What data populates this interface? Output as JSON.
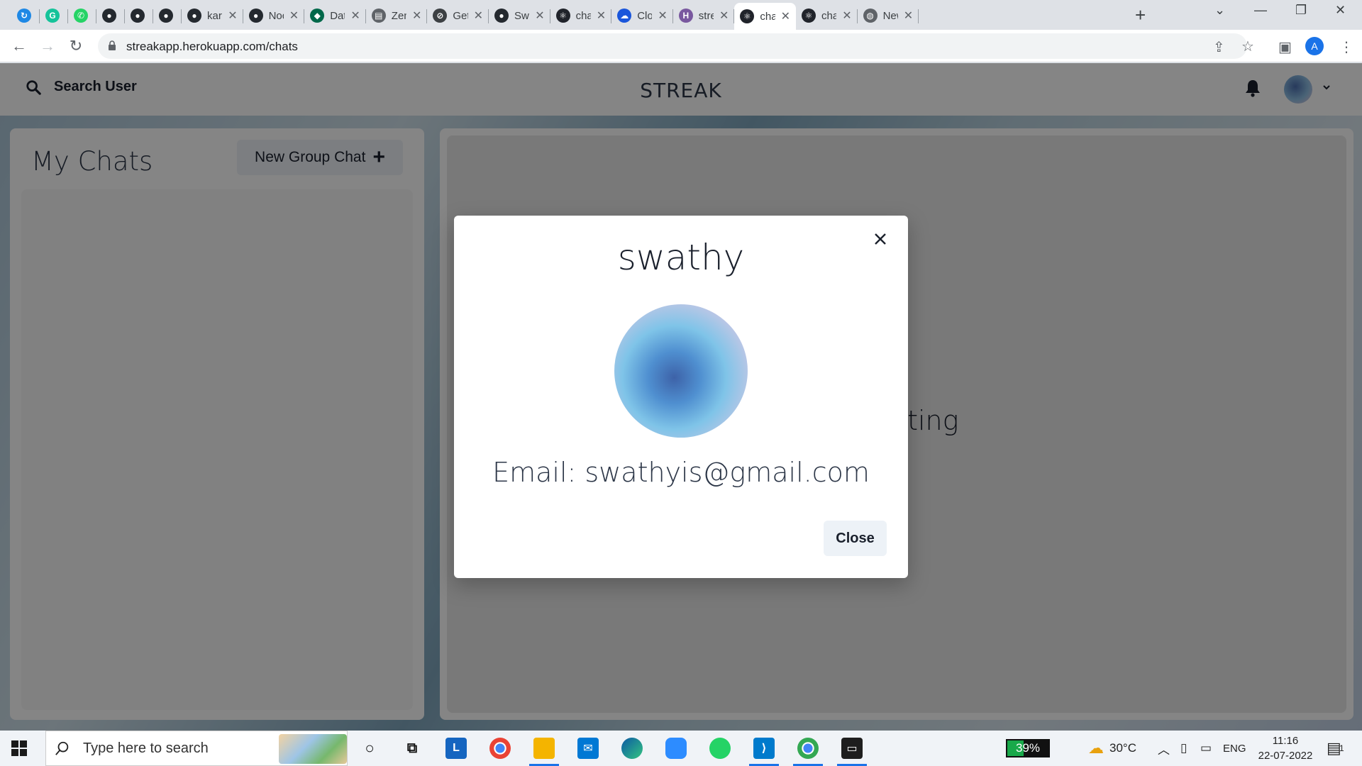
{
  "browser": {
    "tabs": [
      {
        "title": "",
        "icon": "app-icon",
        "color": "#1e88e5"
      },
      {
        "title": "",
        "icon": "grammarly-icon",
        "color": "#15c39a"
      },
      {
        "title": "",
        "icon": "whatsapp-icon",
        "color": "#25d366"
      },
      {
        "title": "",
        "icon": "github-icon",
        "color": "#24292f"
      },
      {
        "title": "",
        "icon": "github-icon",
        "color": "#24292f"
      },
      {
        "title": "",
        "icon": "github-icon",
        "color": "#24292f"
      },
      {
        "title": "kar-",
        "icon": "github-icon",
        "color": "#24292f"
      },
      {
        "title": "Noc",
        "icon": "github-icon",
        "color": "#24292f"
      },
      {
        "title": "Data",
        "icon": "mongodb-icon",
        "color": "#00684a"
      },
      {
        "title": "Zen",
        "icon": "page-icon",
        "color": "#5f6368"
      },
      {
        "title": "Get",
        "icon": "compass-icon",
        "color": "#3c4043"
      },
      {
        "title": "Swa",
        "icon": "github-icon",
        "color": "#24292f"
      },
      {
        "title": "chat",
        "icon": "react-icon",
        "color": "#20232a"
      },
      {
        "title": "Clou",
        "icon": "cloud-icon",
        "color": "#1a56db"
      },
      {
        "title": "stre",
        "icon": "heroku-icon",
        "color": "#79589f"
      },
      {
        "title": "chat",
        "icon": "react-icon",
        "color": "#20232a"
      },
      {
        "title": "chat",
        "icon": "react-icon",
        "color": "#20232a"
      },
      {
        "title": "New",
        "icon": "globe-icon",
        "color": "#5f6368"
      }
    ],
    "active_tab_index": 15,
    "url": "streakapp.herokuapp.com/chats",
    "profile_initial": "A"
  },
  "app": {
    "search_label": "Search User",
    "brand": "STREAK",
    "my_chats_title": "My Chats",
    "new_group_label": "New Group Chat",
    "chatbox_hint": "o start chatting"
  },
  "modal": {
    "name": "swathy",
    "email": "Email: swathyis@gmail.com",
    "close_label": "Close"
  },
  "taskbar": {
    "search_placeholder": "Type here to search",
    "battery_percent": 39,
    "battery_label": "39%",
    "temperature": "30°C",
    "language": "ENG",
    "time": "11:16",
    "date": "22-07-2022",
    "notification_count": "1"
  }
}
